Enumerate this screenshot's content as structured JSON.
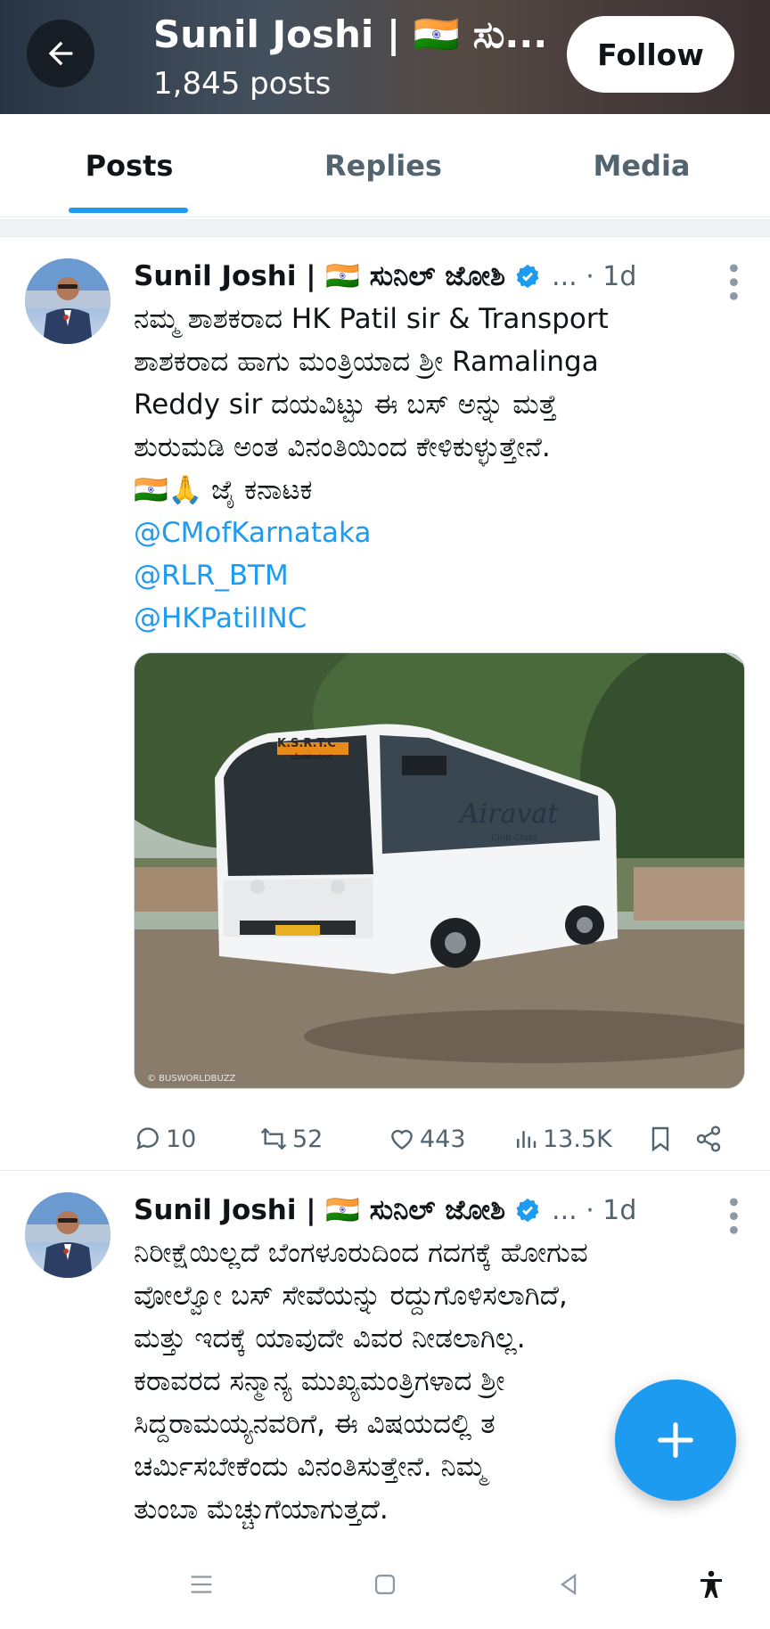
{
  "header": {
    "title": "Sunil Joshi | 🇮🇳 ಸು...",
    "posts_count": "1,845 posts",
    "follow_label": "Follow"
  },
  "tabs": [
    {
      "label": "Posts",
      "active": true
    },
    {
      "label": "Replies",
      "active": false
    },
    {
      "label": "Media",
      "active": false
    }
  ],
  "tweets": [
    {
      "name": "Sunil Joshi | 🇮🇳 ಸುನಿಲ್ ಜೋಶಿ",
      "meta": "... · 1d",
      "text_lines": [
        "ನಮ್ಮ ಶಾಶಕರಾದ HK Patil sir & Transport",
        "ಶಾಶಕರಾದ ಹಾಗು ಮಂತ್ರಿಯಾದ ಶ್ರೀ Ramalinga",
        "Reddy sir ದಯವಿಟ್ಟು ಈ ಬಸ್ ಅನ್ನು ಮತ್ತೆ",
        "ಶುರುಮಡಿ ಅಂತ ವಿನಂತಿಯಿಂದ ಕೇಳಿಕುಳ್ಳುತ್ತೇನೆ.",
        "🇮🇳🙏 ಜೈ ಕನಾಟಕ"
      ],
      "mentions": [
        "@CMofKarnataka",
        "@RLR_BTM",
        "@HKPatilINC"
      ],
      "media": {
        "bus_route_sign": "ಬೆಂಗಳೂರು-ಗ",
        "bus_operator": "K.S.R.T.C",
        "bus_brand": "Airavat",
        "bus_brand_sub": "Club Class",
        "watermark": "© BUSWORLDBUZZ"
      },
      "stats": {
        "replies": "10",
        "reposts": "52",
        "likes": "443",
        "views": "13.5K"
      }
    },
    {
      "name": "Sunil Joshi | 🇮🇳 ಸುನಿಲ್ ಜೋಶಿ",
      "meta": "... · 1d",
      "text_lines": [
        "ನಿರೀಕ್ಷೆಯಿಲ್ಲದೆ ಬೆಂಗಳೂರುದಿಂದ ಗದಗಕ್ಕೆ ಹೋಗುವ",
        "ವೋಲ್ವೋ ಬಸ್ ಸೇವೆಯನ್ನು ರದ್ದುಗೊಳಿಸಲಾಗಿದೆ,",
        "ಮತ್ತು ಇದಕ್ಕೆ ಯಾವುದೇ ವಿವರ ನೀಡಲಾಗಿಲ್ಲ.",
        "ಕರಾವರದ ಸನ್ಮಾನ್ಯ ಮುಖ್ಯಮಂತ್ರಿಗಳಾದ ಶ್ರೀ",
        "ಸಿದ್ದರಾಮಯ್ಯನವರಿಗೆ, ಈ ವಿಷಯದಲ್ಲಿ ತ",
        "ಚರ್ಮಿಸಬೇಕೆಂದು ವಿನಂತಿಸುತ್ತೇನೆ. ನಿಮ್ಮ",
        "ತುಂಬಾ ಮೆಚ್ಚುಗೆಯಾಗುತ್ತದೆ."
      ]
    }
  ],
  "colors": {
    "accent": "#1d9bf0",
    "text_primary": "#0f1419",
    "text_secondary": "#536471"
  },
  "icons": [
    "back-arrow-icon",
    "verified-badge-icon",
    "more-icon",
    "reply-icon",
    "repost-icon",
    "like-icon",
    "views-icon",
    "bookmark-icon",
    "share-icon",
    "compose-plus-icon",
    "nav-recents-icon",
    "nav-home-icon",
    "nav-back-icon",
    "accessibility-icon"
  ]
}
